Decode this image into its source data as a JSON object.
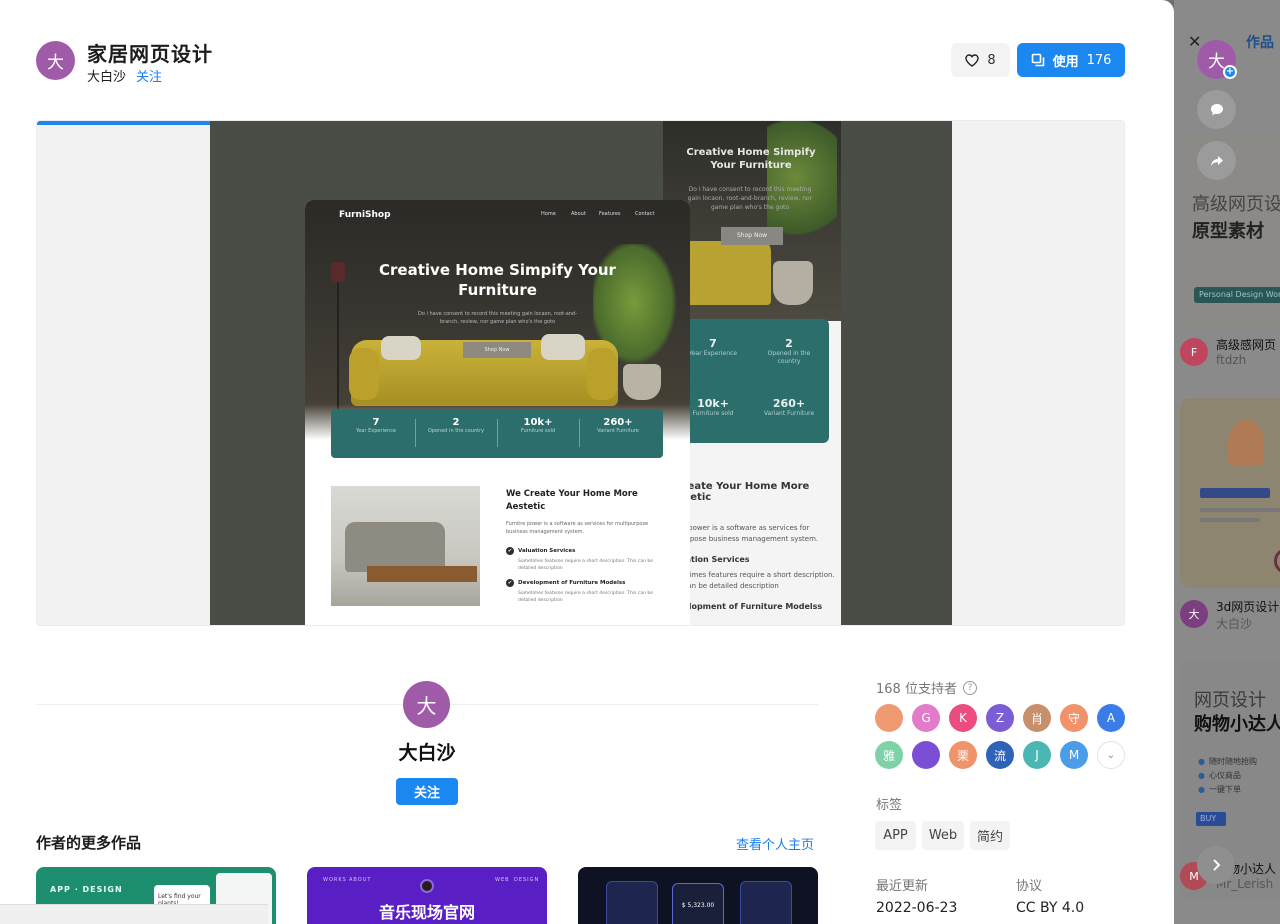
{
  "header": {
    "title": "家居网页设计",
    "author": "大白沙",
    "follow_label": "关注",
    "avatar_char": "大",
    "like_count": "8",
    "use_label": "使用",
    "use_count": "176"
  },
  "preview": {
    "progress_fraction": 0.5,
    "front": {
      "brand": "FurniShop",
      "nav": [
        "Home",
        "About",
        "Features",
        "Contact"
      ],
      "hero_title": "Creative Home Simpify Your Furniture",
      "hero_desc": "Do i have consent to record this meeting gain locaon, root-and-branch, review, nor game plan who's the goto",
      "hero_button": "Shop Now",
      "stats": [
        {
          "num": "7",
          "label": "Year Experience"
        },
        {
          "num": "2",
          "label": "Opened in the country"
        },
        {
          "num": "10k+",
          "label": "Furniture sold"
        },
        {
          "num": "260+",
          "label": "Variant Furniture"
        }
      ],
      "section_title": "We Create Your Home More Aestetic",
      "section_desc": "Furnitre power is a software as services for multipurpose business management system.",
      "services": [
        {
          "title": "Valuation Services",
          "desc": "Sometimes features require a short description. This can be detailed description"
        },
        {
          "title": "Development of Furniture Modelss",
          "desc": "Sometimes features require a short description. This can be detailed description"
        }
      ]
    },
    "back": {
      "hero_title": "Creative Home Simpify Your Furniture",
      "hero_desc": "Do i have consent to record this meeting gain locaon, root-and-branch, review, nor game plan who's the goto",
      "hero_button": "Shop Now",
      "stats": [
        {
          "num": "7",
          "label": "Year Experience"
        },
        {
          "num": "2",
          "label": "Opened in the country"
        },
        {
          "num": "10k+",
          "label": "Furniture sold"
        },
        {
          "num": "260+",
          "label": "Variant Furniture"
        }
      ],
      "section_title": "e Create Your Home More Aestetic",
      "section_desc": "rnitre power is a software as services for ultipurpose business management system.",
      "service1": "Valuation Services",
      "service1_desc": "Sometimes features require a short description. This can be detailed description",
      "service2": "Development of Furniture Modelss"
    }
  },
  "author_block": {
    "avatar_char": "大",
    "name": "大白沙",
    "follow_label": "关注"
  },
  "more_works": {
    "title": "作者的更多作品",
    "link": "查看个人主页",
    "items": [
      {
        "caption": "APP · DESIGN",
        "card_text": "Let's find your plants!"
      },
      {
        "caption": "音乐现场官网",
        "nav": [
          "WORKS",
          "ABOUT",
          "WEB",
          "DESIGN"
        ]
      },
      {
        "caption": "$ 5,323.00"
      }
    ]
  },
  "sidebar": {
    "supporters_label": "168 位支持者",
    "help_icon": "question-circle-icon",
    "supporters": [
      {
        "char": "",
        "color": "#ef9a73"
      },
      {
        "char": "G",
        "color": "#e27cc9"
      },
      {
        "char": "K",
        "color": "#ea4d7e"
      },
      {
        "char": "Z",
        "color": "#7b5dd6"
      },
      {
        "char": "肖",
        "color": "#c8906a"
      },
      {
        "char": "守",
        "color": "#f0926a"
      },
      {
        "char": "A",
        "color": "#3b7de8"
      },
      {
        "char": "雅",
        "color": "#7ed2a8"
      },
      {
        "char": "",
        "color": "#7a4fd6"
      },
      {
        "char": "栗",
        "color": "#f0926a"
      },
      {
        "char": "流",
        "color": "#2f63b8"
      },
      {
        "char": "J",
        "color": "#4bb7b2"
      },
      {
        "char": "M",
        "color": "#4b9de8"
      }
    ],
    "tags_label": "标签",
    "tags": [
      "APP",
      "Web",
      "简约"
    ],
    "updated_label": "最近更新",
    "updated_value": "2022-06-23",
    "license_label": "协议",
    "license_value": "CC BY 4.0"
  },
  "background": {
    "tab_label": "作品",
    "card1": {
      "line1": "高级网页设",
      "line2": "原型素材",
      "pill": "Personal Design Works"
    },
    "author1": {
      "avatar": "F",
      "title": "高级感网页",
      "name": "ftdzh",
      "color": "#c0455e"
    },
    "author2": {
      "avatar": "大",
      "title": "3d网页设计",
      "name": "大白沙",
      "color": "#7b3f80"
    },
    "card3": {
      "line1": "网页设计",
      "line2": "购物小达人",
      "items": [
        "随时随地抢购",
        "心仪商品",
        "一键下单"
      ],
      "buy": "BUY"
    },
    "author3": {
      "avatar": "M",
      "title": "购物小达人",
      "name": "Mr_Lerish",
      "color": "#b04a54"
    },
    "float_avatar": "大"
  }
}
